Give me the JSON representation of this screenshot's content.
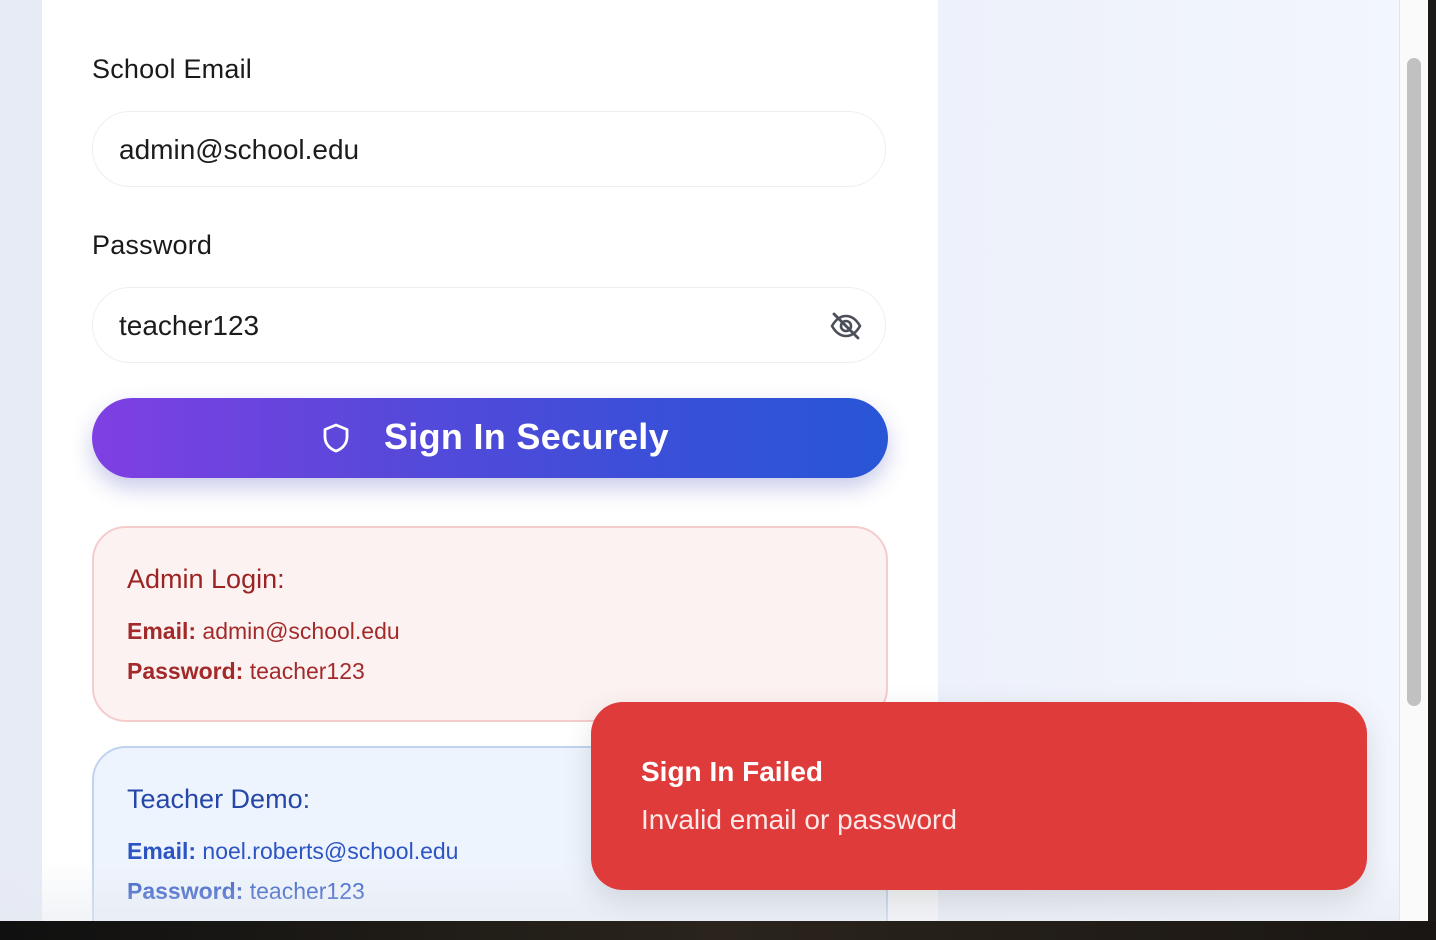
{
  "form": {
    "email_label": "School Email",
    "email_value": "admin@school.edu",
    "password_label": "Password",
    "password_value": "teacher123",
    "password_toggle_icon": "eye-off-icon",
    "submit_label": "Sign In Securely",
    "submit_icon": "shield-icon"
  },
  "demo_admin": {
    "title": "Admin Login:",
    "email_key": "Email:",
    "email_value": "admin@school.edu",
    "password_key": "Password:",
    "password_value": "teacher123"
  },
  "demo_teacher": {
    "title": "Teacher Demo:",
    "email_key": "Email:",
    "email_value": "noel.roberts@school.edu",
    "password_key": "Password:",
    "password_value": "teacher123"
  },
  "toast": {
    "title": "Sign In Failed",
    "message": "Invalid email or password"
  },
  "colors": {
    "button_gradient_start": "#7f3fe3",
    "button_gradient_end": "#2856d6",
    "toast_bg": "#e03b3b",
    "admin_text": "#a32a2a",
    "teacher_text": "#2c55c3"
  }
}
